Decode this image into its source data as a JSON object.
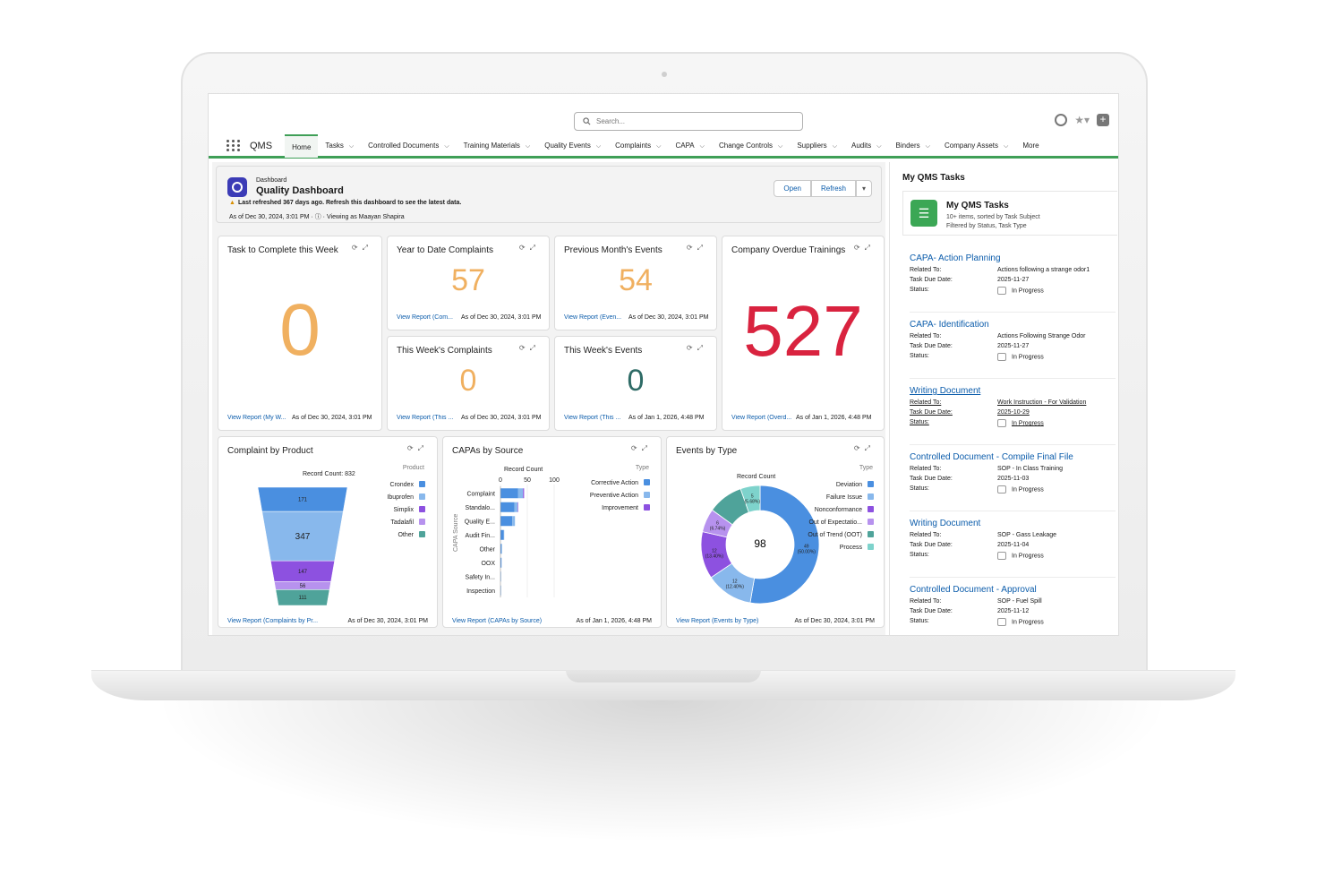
{
  "app": {
    "name": "QMS"
  },
  "search": {
    "placeholder": "Search..."
  },
  "nav": [
    {
      "label": "Home",
      "active": true,
      "chevron": false
    },
    {
      "label": "Tasks",
      "chevron": true
    },
    {
      "label": "Controlled Documents",
      "chevron": true
    },
    {
      "label": "Training Materials",
      "chevron": true
    },
    {
      "label": "Quality Events",
      "chevron": true
    },
    {
      "label": "Complaints",
      "chevron": true
    },
    {
      "label": "CAPA",
      "chevron": true
    },
    {
      "label": "Change Controls",
      "chevron": true
    },
    {
      "label": "Suppliers",
      "chevron": true
    },
    {
      "label": "Audits",
      "chevron": true
    },
    {
      "label": "Binders",
      "chevron": true
    },
    {
      "label": "Company Assets",
      "chevron": true
    },
    {
      "label": "More",
      "chevron": false
    }
  ],
  "dashboard": {
    "kicker": "Dashboard",
    "title": "Quality Dashboard",
    "warning": "Last refreshed 367 days ago. Refresh this dashboard to see the latest data.",
    "as_of": "As of Dec 30, 2024, 3:01 PM",
    "viewing_as": "Viewing as Maayan Shapira",
    "open_label": "Open",
    "refresh_label": "Refresh"
  },
  "metrics": {
    "task_week": {
      "title": "Task to Complete this Week",
      "value": "0",
      "link": "View Report (My W...",
      "date": "As of Dec 30, 2024, 3:01 PM",
      "color": "#f0b060"
    },
    "ytd_complaints": {
      "title": "Year to Date Complaints",
      "value": "57",
      "link": "View Report (Com...",
      "date": "As of Dec 30, 2024, 3:01 PM",
      "color": "#f0b060"
    },
    "prev_month_events": {
      "title": "Previous Month's Events",
      "value": "54",
      "link": "View Report (Even...",
      "date": "As of Dec 30, 2024, 3:01 PM",
      "color": "#f0b060"
    },
    "overdue_trainings": {
      "title": "Company Overdue Trainings",
      "value": "527",
      "link": "View Report (Overd...",
      "date": "As of Jan 1, 2026, 4:48 PM",
      "color": "#d9233f"
    },
    "week_complaints": {
      "title": "This Week's Complaints",
      "value": "0",
      "link": "View Report (This ...",
      "date": "As of Dec 30, 2024, 3:01 PM",
      "color": "#f0b060"
    },
    "week_events": {
      "title": "This Week's Events",
      "value": "0",
      "link": "View Report (This ...",
      "date": "As of Jan 1, 2026, 4:48 PM",
      "color": "#2e6b66"
    }
  },
  "chart_labels": {
    "complaint": {
      "title": "Complaint by Product",
      "record": "Record Count: 832",
      "legend_title": "Product",
      "link": "View Report (Complaints by Pr...",
      "date": "As of Dec 30, 2024, 3:01 PM"
    },
    "capa": {
      "title": "CAPAs by Source",
      "record": "Record Count",
      "legend_title": "Type",
      "axis_title": "CAPA Source",
      "link": "View Report (CAPAs by Source)",
      "date": "As of Jan 1, 2026, 4:48 PM"
    },
    "events": {
      "title": "Events by Type",
      "record": "Record Count",
      "legend_title": "Type",
      "total": "98",
      "link": "View Report (Events by Type)",
      "date": "As of Dec 30, 2024, 3:01 PM"
    }
  },
  "chart_data": [
    {
      "type": "funnel",
      "title": "Complaint by Product",
      "categories": [
        "Crondex",
        "Ibuprofen",
        "Simplix",
        "Tadalafil",
        "Other"
      ],
      "values": [
        171,
        347,
        147,
        56,
        111
      ],
      "colors": [
        "#4a8fe0",
        "#88b8ec",
        "#8d51e0",
        "#b792ee",
        "#4fa39a"
      ],
      "total": 832
    },
    {
      "type": "bar",
      "orientation": "horizontal",
      "stacked": true,
      "title": "CAPAs by Source",
      "categories": [
        "Complaint",
        "Standalo...",
        "Quality E...",
        "Audit Fin...",
        "Other",
        "OOX",
        "Safety In...",
        "Inspection"
      ],
      "xlim": [
        0,
        100
      ],
      "xticks": [
        0,
        50,
        100
      ],
      "series": [
        {
          "name": "Corrective Action",
          "color": "#4a8fe0",
          "values": [
            33,
            26,
            22,
            6,
            2,
            2,
            1,
            1
          ]
        },
        {
          "name": "Preventive Action",
          "color": "#88b8ec",
          "values": [
            9,
            6,
            5,
            1,
            1,
            0,
            0,
            0
          ]
        },
        {
          "name": "Improvement",
          "color": "#8d51e0",
          "values": [
            2,
            1,
            0,
            0,
            0,
            0,
            0,
            0
          ]
        }
      ]
    },
    {
      "type": "donut",
      "title": "Events by Type",
      "total": 98,
      "categories": [
        "Deviation",
        "Failure Issue",
        "Nonconformance",
        "Out of Expectatio...",
        "Out of Trend (OOT)",
        "Process"
      ],
      "values": [
        49,
        12,
        12,
        6,
        9,
        5
      ],
      "slice_labels": [
        "49 (50.00%)",
        "12 (12.40%)",
        "12 (13.40%)",
        "6 (6.74%)",
        "",
        "5 (5.68%)"
      ],
      "colors": [
        "#4a8fe0",
        "#88b8ec",
        "#8d51e0",
        "#b792ee",
        "#4fa39a",
        "#7ed3cc"
      ]
    }
  ],
  "sidebar": {
    "heading": "My QMS Tasks",
    "hero_title": "My QMS Tasks",
    "hero_sub1": "10+ items, sorted by Task Subject",
    "hero_sub2": "Filtered by Status, Task Type",
    "related_label": "Related To:",
    "due_label": "Task Due Date:",
    "status_label": "Status:",
    "tasks": [
      {
        "title": "CAPA- Action Planning",
        "related": "Actions following a strange odor1",
        "due": "2025-11-27",
        "status": "In Progress"
      },
      {
        "title": "CAPA- Identification",
        "related": "Actions Following Strange Odor",
        "due": "2025-11-27",
        "status": "In Progress"
      },
      {
        "title": "Writing Document",
        "related": "Work Instruction - For Validation",
        "due": "2025-10-29",
        "status": "In Progress"
      },
      {
        "title": "Controlled Document - Compile Final File",
        "related": "SOP - In Class Training",
        "due": "2025-11-03",
        "status": "In Progress"
      },
      {
        "title": "Writing Document",
        "related": "SOP - Gass Leakage",
        "due": "2025-11-04",
        "status": "In Progress"
      },
      {
        "title": "Controlled Document - Approval",
        "related": "SOP - Fuel Spill",
        "due": "2025-11-12",
        "status": "In Progress"
      }
    ]
  }
}
